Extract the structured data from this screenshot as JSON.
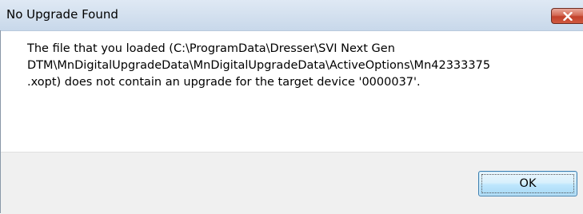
{
  "window": {
    "title": "No Upgrade Found",
    "close_icon": "close-icon"
  },
  "message": {
    "line1": "The file that you loaded (C:\\ProgramData\\Dresser\\SVI Next Gen",
    "line2": "DTM\\MnDigitalUpgradeData\\MnDigitalUpgradeData\\ActiveOptions\\Mn42333375",
    "line3": ".xopt) does not contain an upgrade for the target device '0000037'."
  },
  "buttons": {
    "ok_label": "OK"
  }
}
